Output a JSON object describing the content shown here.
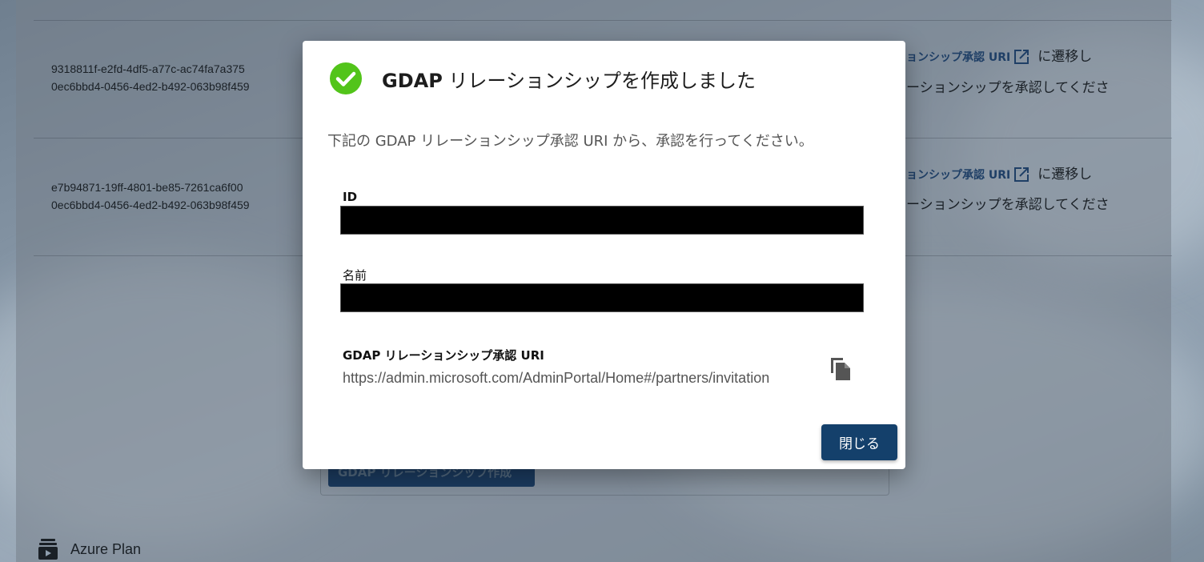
{
  "background": {
    "rows": [
      {
        "line1": "9318811f-e2fd-4df5-a77c-ac74fa7a375",
        "line2": "0ec6bbd4-0456-4ed2-b492-063b98f459",
        "link_text": "ョンシップ承認 URI",
        "suffix1": "に遷移し",
        "line_b": "ーションシップを承認してくださ"
      },
      {
        "line1": "e7b94871-19ff-4801-be85-7261ca6f00",
        "line2": "0ec6bbd4-0456-4ed2-b492-063b98f459",
        "link_text": "ョンシップ承認 URI",
        "suffix1": "に遷移し",
        "line_b": "ーションシップを承認してくださ"
      }
    ],
    "create_button_label": "GDAP リレーションシップ作成",
    "azure_plan_label": "Azure Plan"
  },
  "dialog": {
    "title_bold": "GDAP",
    "title_rest": " リレーションシップを作成しました",
    "description": "下記の GDAP リレーションシップ承認 URI から、承認を行ってください。",
    "id_label": "ID",
    "name_label": "名前",
    "uri_label": "GDAP リレーションシップ承認 URI",
    "uri_value": "https://admin.microsoft.com/AdminPortal/Home#/partners/invitation",
    "close_label": "閉じる"
  },
  "colors": {
    "success": "#52c41a",
    "primary_button": "#14406b",
    "link": "#1f3f66"
  },
  "icons": {
    "success": "check-circle-icon",
    "copy": "copy-icon",
    "external_link": "external-link-icon",
    "plan": "plan-icon"
  }
}
